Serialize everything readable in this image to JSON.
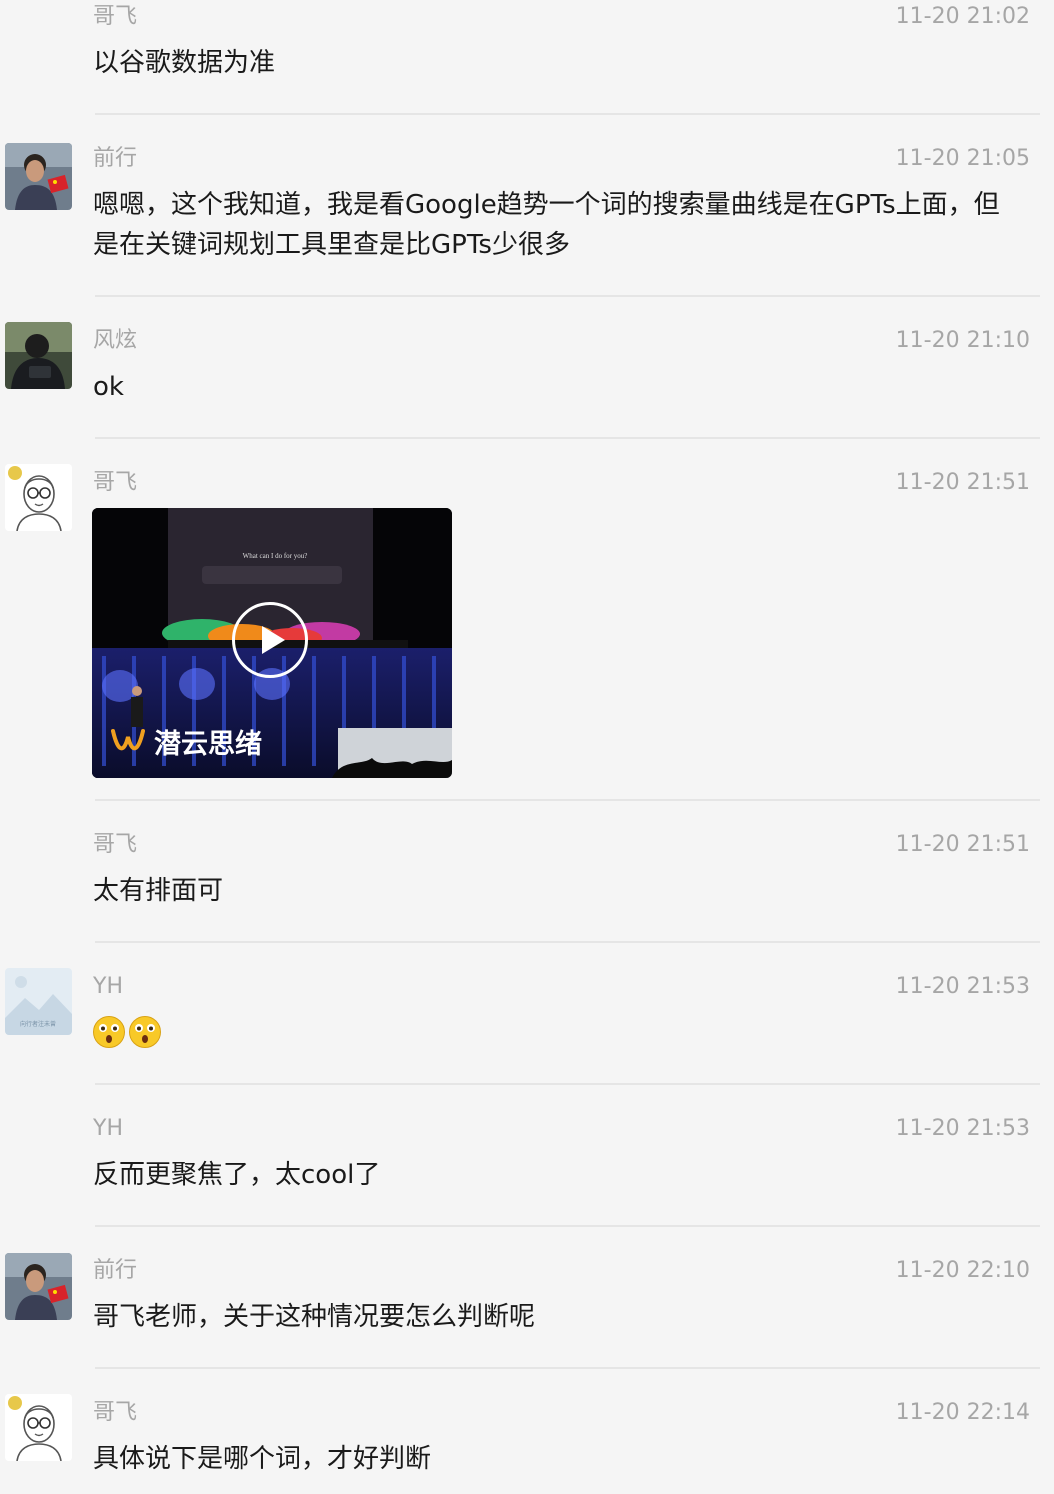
{
  "messages": [
    {
      "sender": "哥飞",
      "time": "11-20 21:02",
      "text": "以谷歌数据为准",
      "avatar": "none"
    },
    {
      "sender": "前行",
      "time": "11-20 21:05",
      "text": "嗯嗯，这个我知道，我是看Google趋势一个词的搜索量曲线是在GPTs上面，但是在关键词规划工具里查是比GPTs少很多",
      "avatar": "photo-man-flag"
    },
    {
      "sender": "风炫",
      "time": "11-20 21:10",
      "text": "ok",
      "avatar": "photo-dark"
    },
    {
      "sender": "哥飞",
      "time": "11-20 21:51",
      "type": "video",
      "avatar": "cartoon-glasses-man"
    },
    {
      "sender": "哥飞",
      "time": "11-20 21:51",
      "text": "太有排面可",
      "avatar": "none"
    },
    {
      "sender": "YH",
      "time": "11-20 21:53",
      "type": "emoji",
      "avatar": "landscape-placeholder"
    },
    {
      "sender": "YH",
      "time": "11-20 21:53",
      "text": "反而更聚焦了，太cool了",
      "avatar": "none"
    },
    {
      "sender": "前行",
      "time": "11-20 22:10",
      "text": "哥飞老师，关于这种情况要怎么判断呢",
      "avatar": "photo-man-flag"
    },
    {
      "sender": "哥飞",
      "time": "11-20 22:14",
      "text": "具体说下是哪个词，才好判断",
      "avatar": "cartoon-glasses-man"
    }
  ],
  "video": {
    "screen_prompt": "What can I do for you?",
    "watermark": "潜云思绪",
    "icon": "play-icon"
  },
  "emojis": [
    "astonished-face-icon",
    "astonished-face-icon"
  ],
  "avatar_caption": "向行者注未曾",
  "colors": {
    "background": "#f5f5f5",
    "meta": "#a6a6a6",
    "text": "#1a1a1a",
    "divider": "#e5e5e5"
  }
}
